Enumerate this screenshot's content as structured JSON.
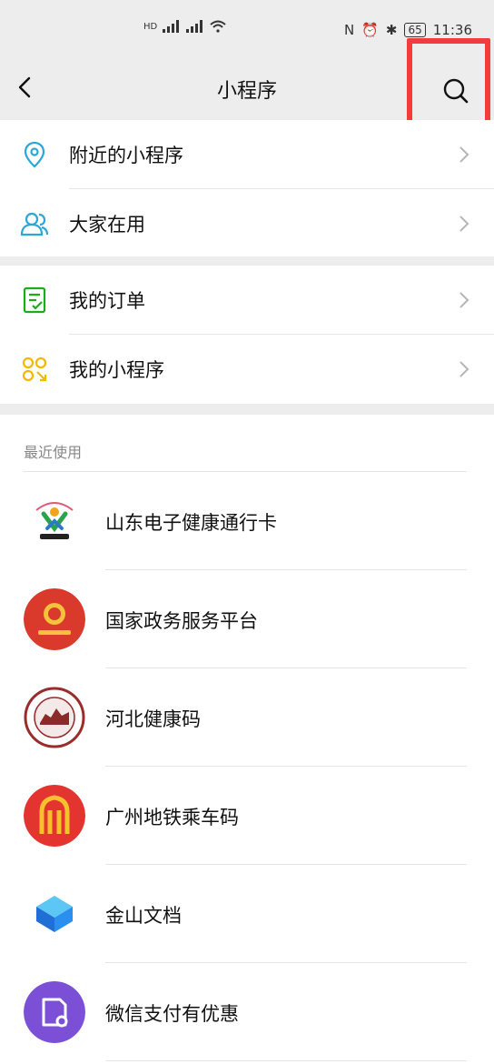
{
  "status_bar": {
    "left_icons": [
      "HD",
      "46",
      "46",
      "wifi"
    ],
    "time": "11:36",
    "battery": "65"
  },
  "header": {
    "title": "小程序"
  },
  "menu_group_1": [
    {
      "label": "附近的小程序",
      "icon": "location-pin-icon",
      "color": "#07c160"
    },
    {
      "label": "大家在用",
      "icon": "people-icon",
      "color": "#1aad19"
    }
  ],
  "menu_group_2": [
    {
      "label": "我的订单",
      "icon": "order-list-icon",
      "color": "#07c160"
    },
    {
      "label": "我的小程序",
      "icon": "mini-program-icon",
      "color": "#f5b700"
    }
  ],
  "recent": {
    "label": "最近使用",
    "apps": [
      {
        "name": "山东电子健康通行卡",
        "logo": "shandong-health-logo"
      },
      {
        "name": "国家政务服务平台",
        "logo": "national-gov-service-logo"
      },
      {
        "name": "河北健康码",
        "logo": "hebei-health-logo"
      },
      {
        "name": "广州地铁乘车码",
        "logo": "guangzhou-metro-logo"
      },
      {
        "name": "金山文档",
        "logo": "kingsoft-docs-logo"
      },
      {
        "name": "微信支付有优惠",
        "logo": "wechat-pay-discount-logo"
      }
    ]
  },
  "colors": {
    "highlight": "#f43b3b",
    "background": "#ededed"
  }
}
